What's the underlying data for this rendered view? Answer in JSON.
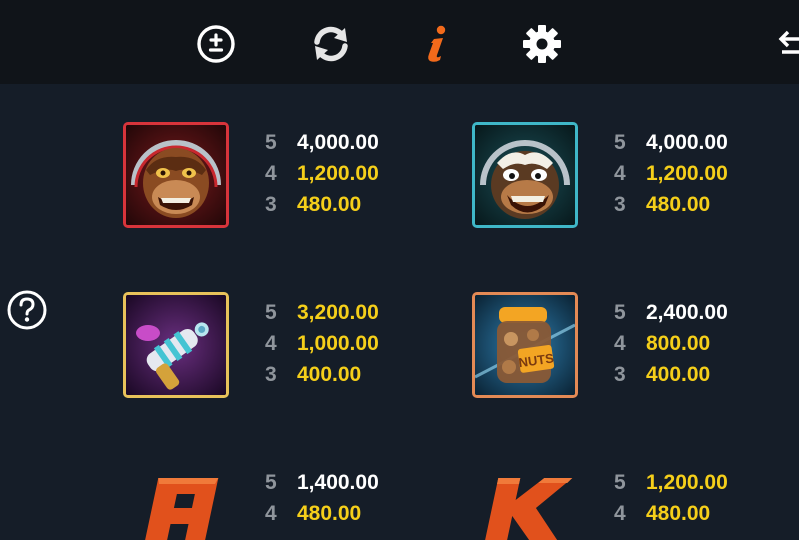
{
  "toolbar": {
    "icons": [
      "bet-adjust-icon",
      "autoplay-icon",
      "info-icon",
      "settings-icon",
      "exit-icon"
    ],
    "accent_color": "#f26a1b"
  },
  "help": {
    "icon": "question-icon"
  },
  "symbols": [
    {
      "name": "red-monkey-astronaut",
      "frame_color": "#d8343b",
      "payouts": [
        {
          "count": "5",
          "value": "4,000.00",
          "color": "white"
        },
        {
          "count": "4",
          "value": "1,200.00",
          "color": "gold"
        },
        {
          "count": "3",
          "value": "480.00",
          "color": "gold"
        }
      ]
    },
    {
      "name": "teal-monkey-astronaut",
      "frame_color": "#3fb7c8",
      "payouts": [
        {
          "count": "5",
          "value": "4,000.00",
          "color": "white"
        },
        {
          "count": "4",
          "value": "1,200.00",
          "color": "gold"
        },
        {
          "count": "3",
          "value": "480.00",
          "color": "gold"
        }
      ]
    },
    {
      "name": "ray-gun",
      "frame_color": "#e8c25a",
      "payouts": [
        {
          "count": "5",
          "value": "3,200.00",
          "color": "gold"
        },
        {
          "count": "4",
          "value": "1,000.00",
          "color": "gold"
        },
        {
          "count": "3",
          "value": "400.00",
          "color": "gold"
        }
      ]
    },
    {
      "name": "nuts-jar",
      "label": "NUTS",
      "frame_color": "#e38a55",
      "payouts": [
        {
          "count": "5",
          "value": "2,400.00",
          "color": "white"
        },
        {
          "count": "4",
          "value": "800.00",
          "color": "gold"
        },
        {
          "count": "3",
          "value": "400.00",
          "color": "gold"
        }
      ]
    },
    {
      "name": "letter-a",
      "label": "A",
      "payouts": [
        {
          "count": "5",
          "value": "1,400.00",
          "color": "white"
        },
        {
          "count": "4",
          "value": "480.00",
          "color": "gold"
        }
      ]
    },
    {
      "name": "letter-k",
      "label": "K",
      "payouts": [
        {
          "count": "5",
          "value": "1,200.00",
          "color": "gold"
        },
        {
          "count": "4",
          "value": "480.00",
          "color": "gold"
        }
      ]
    }
  ]
}
